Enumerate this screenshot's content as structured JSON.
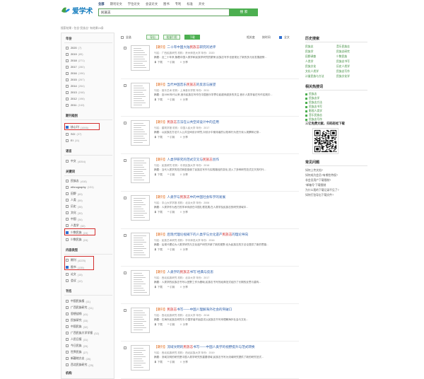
{
  "header": {
    "logo_text": "爱学术",
    "nav": [
      "全部",
      "期刊论文",
      "学位论文",
      "会议论文",
      "图书",
      "专利",
      "标准",
      "开文"
    ],
    "search_value": "民族志",
    "search_button": "搜 索"
  },
  "breadcrumb": "搜索结果 › 包含\"民族志\"  有结果24条",
  "sidebar": {
    "year": {
      "title": "年份",
      "items": [
        {
          "label": "2020",
          "count": "(7)"
        },
        {
          "label": "2019",
          "count": "(85)"
        },
        {
          "label": "2018",
          "count": "(271)"
        },
        {
          "label": "2017",
          "count": "(280)"
        },
        {
          "label": "2016",
          "count": "(196)"
        },
        {
          "label": "2015",
          "count": "(267)"
        },
        {
          "label": "2014",
          "count": "(264)"
        },
        {
          "label": "2013",
          "count": "(248)"
        },
        {
          "label": "2012",
          "count": "(198)"
        },
        {
          "label": "2011",
          "count": "(163)"
        }
      ]
    },
    "level": {
      "title": "期刊级别",
      "items": [
        {
          "label": "核心刊",
          "count": "(1006)",
          "checked": true
        },
        {
          "label": "SCI",
          "count": "(37)",
          "checked": false
        },
        {
          "label": "EI",
          "count": "(11)",
          "checked": false
        }
      ]
    },
    "language": {
      "title": "语言",
      "items": [
        {
          "label": "中文",
          "count": "(4054)"
        }
      ]
    },
    "keywords": {
      "title": "关键词",
      "items": [
        {
          "label": "民族志",
          "count": "(418)",
          "checked": false
        },
        {
          "label": "ethnography",
          "count": "(131)",
          "checked": false
        },
        {
          "label": "田野",
          "count": "(63)",
          "checked": false
        },
        {
          "label": "人类",
          "count": "(59)",
          "checked": false
        },
        {
          "label": "历史",
          "count": "(35)",
          "checked": false
        },
        {
          "label": "文化",
          "count": "(30)",
          "checked": false
        },
        {
          "label": "中国",
          "count": "(34)",
          "checked": false
        },
        {
          "label": "人类学",
          "count": "(32)",
          "checked": true
        },
        {
          "label": "少数民族",
          "count": "(24)",
          "checked": false
        }
      ]
    },
    "type": {
      "title": "内容类型",
      "items": [
        {
          "label": "期刊",
          "count": "(4225)",
          "checked": false
        },
        {
          "label": "图书",
          "count": "(135)",
          "checked": true
        },
        {
          "label": "论文",
          "count": "(15)",
          "checked": false
        },
        {
          "label": "会议",
          "count": "(12)",
          "checked": false
        }
      ]
    },
    "journal": {
      "title": "刊名",
      "items": [
        {
          "label": "中国民族报",
          "count": "(11)"
        },
        {
          "label": "广西民族研究",
          "count": "(11)"
        },
        {
          "label": "思想战线",
          "count": "(41)"
        },
        {
          "label": "民族研究",
          "count": "(33)"
        },
        {
          "label": "中国民族",
          "count": "(32)"
        },
        {
          "label": "广西民族大学学报",
          "count": "(32)"
        },
        {
          "label": "人民日报",
          "count": "(31)"
        },
        {
          "label": "今日民族",
          "count": "(29)"
        },
        {
          "label": "世界民族",
          "count": "(27)"
        },
        {
          "label": "新疆地方志",
          "count": "(26)"
        },
        {
          "label": "西北民族研究",
          "count": "(25)"
        }
      ]
    },
    "institution_title": "机构"
  },
  "toolbar": {
    "select_all": "全选",
    "btn_export": "导出",
    "btn_cite": "批量引用",
    "btn_download": "下载",
    "sort_label": "相关度",
    "sort_time": "按时间",
    "fulltext": "全文"
  },
  "results": [
    {
      "prefix": "【期刊】",
      "title_pre": "二十年中国大陆",
      "title_kw": "民族志",
      "title_post": "研究的述评",
      "meta": "刊名：广西民族研究    机构：贵州师范大学    年份：2020",
      "abstract": "摘要：近二十年来,随着中国人类学和民族学研究的繁荣,民族志写作也呈现出了新的多元化发展趋势..."
    },
    {
      "prefix": "【期刊】",
      "title_pre": "当代中国音乐",
      "title_kw": "民族志",
      "title_post": "的反思与展望",
      "meta": "刊名：音乐艺术    机构：上海音乐学院    年份：2011",
      "abstract": "摘要：自1980年代以来,音乐民族志写作在中国音乐学界引起越来越多的关注,音乐人类学者在写作实践中..."
    },
    {
      "prefix": "【期刊】",
      "title_pre": "",
      "title_kw": "民族志",
      "title_post": "方法在公共空间设计中的应用",
      "meta": "刊名：建筑学报    机构：中国人民大学    年份：2017",
      "abstract": "摘要：以民族志方法介入公共空间设计研究,对设计中使用者的认知和行为进行深入观察和记录..."
    },
    {
      "prefix": "【期刊】",
      "title_pre": "人类学研究的范式交叉与",
      "title_kw": "民族志",
      "title_post": "创作",
      "meta": "刊名：民族研究    机构：中央民族大学    年份：2016",
      "abstract": "摘要：当代人类学的范式转型促使了民族志写作与实践路径的变化,进入了多种研究范式交叉的时代..."
    },
    {
      "prefix": "【期刊】",
      "title_pre": "人类学与",
      "title_kw": "民族志",
      "title_post": "中的中国社会科学的发展",
      "meta": "刊名：中山大学学报    机构：北京大学    年份：2006",
      "abstract": "摘要：人类学作为西方的学术传统在中国扎根发展,在人类学及民族志的研究领域中..."
    },
    {
      "prefix": "【期刊】",
      "title_pre": "后现代理论视阈下的人类学与文化遗产",
      "title_kw": "民族志",
      "title_post": "的理论导向",
      "meta": "刊名：民族艺术研究    机构：华中师范大学    年份：2016",
      "abstract": "摘要：后现代理论为人类学研究与文化遗产研究开辟了新的视野,也为民族志的方法论提供了新的思路..."
    },
    {
      "prefix": "【期刊】",
      "title_pre": "人类学的",
      "title_kw": "民族志",
      "title_post": "书写:经典与反思",
      "meta": "刊名：西北民族研究    机构：北京大学    年份：2017",
      "abstract": "摘要：人类学的民族志书写以田野工作为基础,民族志书写的经典范式经历了长期的反思与重构..."
    },
    {
      "prefix": "【期刊】",
      "title_pre": "",
      "title_kw": "民族志",
      "title_post": "书写——中国人理解海外社会的突破口",
      "meta": "刊名：西北民族研究    机构：北京大学    年份：2018",
      "abstract": "摘要：在海外民族志研究中,中国学者开始尝试以民族志书写来理解海外社会与文化..."
    },
    {
      "prefix": "【期刊】",
      "title_pre": "流域文明的",
      "title_kw": "民族志",
      "title_post": "书写——中国人类学的视野提升与范式转换",
      "meta": "刊名：西北民族研究    机构：西北民族大学    年份：2019",
      "abstract": "摘要：流域文明的研究是中国人类学研究的重要领域,民族志书写为流域研究提供了新的研究范式..."
    }
  ],
  "actions": {
    "download": "下载",
    "cite": "引用",
    "share": "分享"
  },
  "right": {
    "history_title": "历史搜索",
    "history_left": [
      "民族志",
      "民族学",
      "田野调查",
      "人类学",
      "民族文化",
      "文化人类学",
      "计量民族与方法"
    ],
    "history_right": [
      "音乐民族志",
      "民族志研究",
      "少数民族",
      "民族志书写",
      "历史人类学",
      "民族志写作",
      "民族文化学"
    ],
    "related_title": "相关热搜词",
    "related": [
      "民族志",
      "民族志学",
      "民族志方法",
      "民族志书写",
      "影视人类学",
      "音乐民族志",
      "民族志写作"
    ],
    "app_title": "三亿免费文献，扫码轻松下载",
    "faq_title": "常见问题",
    "faq": [
      "如何上传文档?",
      "如何成为会员?有哪些特权?",
      "非会员用户下载限制?",
      "\"邮箱号\"下载限制",
      "为什么我的下载记录不见了?",
      "如何打包导出下载文件?"
    ]
  }
}
